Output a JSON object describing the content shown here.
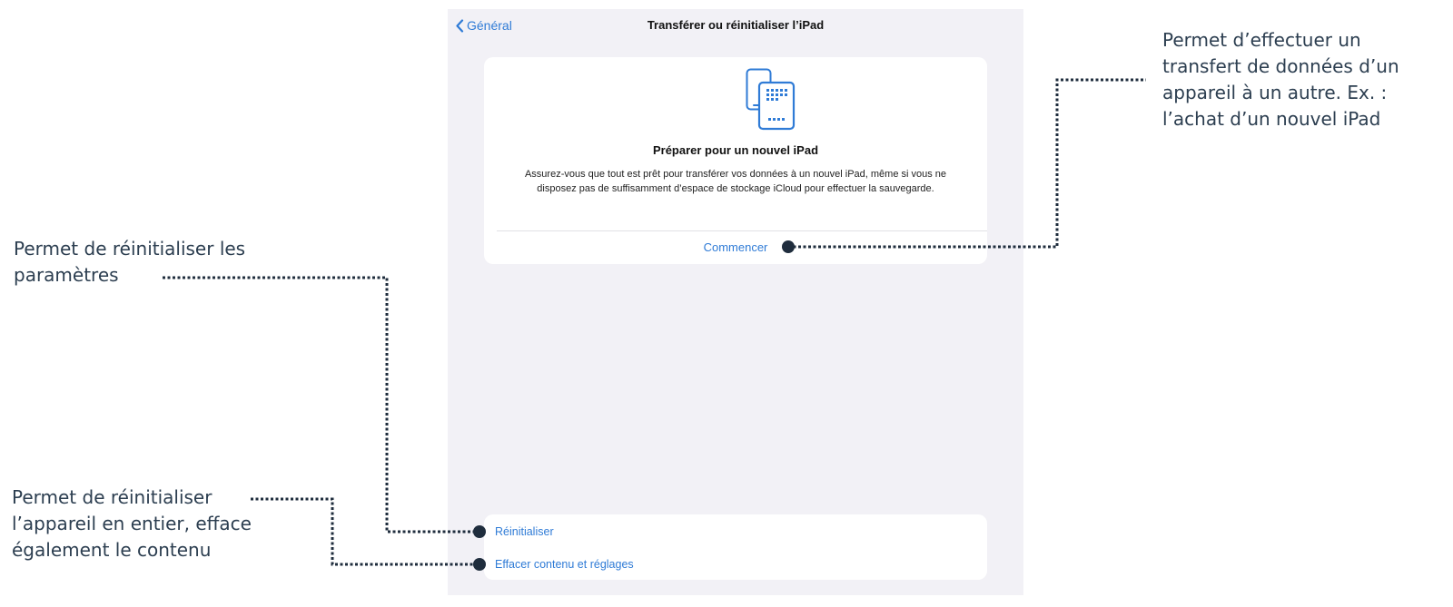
{
  "nav": {
    "back_label": "Général",
    "title": "Transférer ou réinitialiser l’iPad"
  },
  "prepare_card": {
    "icon": "ipad-transfer-icon",
    "title": "Préparer pour un nouvel iPad",
    "description": "Assurez-vous que tout est prêt pour transférer vos données à un nouvel iPad, même si vous ne disposez pas de suffisamment d’espace de stockage iCloud pour effectuer la sauvegarde.",
    "action_label": "Commencer"
  },
  "reset_group": {
    "items": [
      {
        "label": "Réinitialiser"
      },
      {
        "label": "Effacer contenu et réglages"
      }
    ]
  },
  "annotations": {
    "transfer_note": [
      "Permet d’effectuer un",
      "transfert de données d’un",
      "appareil à un autre. Ex. :",
      "l’achat d’un nouvel iPad"
    ],
    "reset_settings_note": [
      "Permet de réinitialiser les",
      "paramètres"
    ],
    "erase_note": [
      "Permet de réinitialiser",
      "l’appareil en entier, efface",
      "également le contenu"
    ]
  },
  "colors": {
    "accent": "#2f7bd6",
    "panel_bg": "#f2f1f6",
    "annotation": "#2c3e50"
  }
}
